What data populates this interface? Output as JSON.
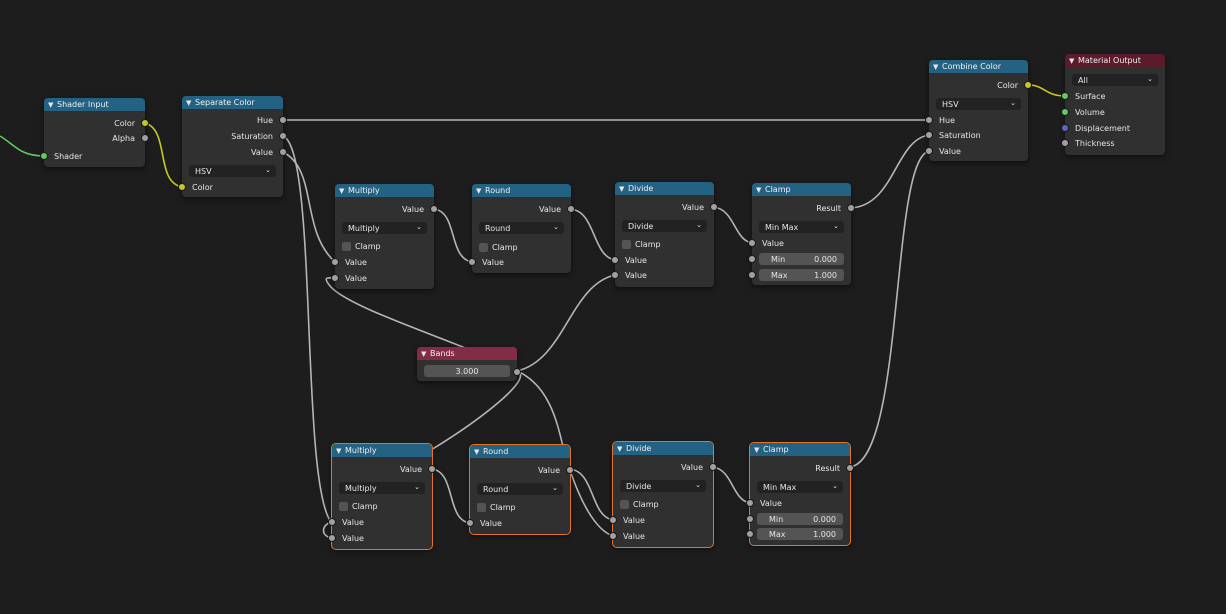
{
  "colors": {
    "background": "#1d1d1d",
    "node_body": "#303030",
    "header_blue": "#246283",
    "header_red": "#822c45",
    "header_output": "#5b1b2b",
    "selected_outline": "#e3752b",
    "link_grey": "#b5b5b5",
    "link_yellow": "#c7c729",
    "link_green": "#63c763"
  },
  "nodes": {
    "shader_input": {
      "title": "Shader Input",
      "out_color": "Color",
      "out_alpha": "Alpha",
      "in_shader": "Shader"
    },
    "separate_color": {
      "title": "Separate Color",
      "out_hue": "Hue",
      "out_saturation": "Saturation",
      "out_value": "Value",
      "mode": "HSV",
      "in_color": "Color"
    },
    "combine_color": {
      "title": "Combine Color",
      "out_color": "Color",
      "mode": "HSV",
      "in_hue": "Hue",
      "in_saturation": "Saturation",
      "in_value": "Value"
    },
    "material_output": {
      "title": "Material Output",
      "target": "All",
      "in_surface": "Surface",
      "in_volume": "Volume",
      "in_displacement": "Displacement",
      "in_thickness": "Thickness"
    },
    "multiply_top": {
      "title": "Multiply",
      "out_value": "Value",
      "operation": "Multiply",
      "clamp": "Clamp",
      "in_value_1": "Value",
      "in_value_2": "Value"
    },
    "round_top": {
      "title": "Round",
      "out_value": "Value",
      "operation": "Round",
      "clamp": "Clamp",
      "in_value": "Value"
    },
    "divide_top": {
      "title": "Divide",
      "out_value": "Value",
      "operation": "Divide",
      "clamp": "Clamp",
      "in_value_1": "Value",
      "in_value_2": "Value"
    },
    "clamp_top": {
      "title": "Clamp",
      "out_result": "Result",
      "type": "Min Max",
      "in_value": "Value",
      "min_label": "Min",
      "min_value": "0.000",
      "max_label": "Max",
      "max_value": "1.000"
    },
    "bands": {
      "title": "Bands",
      "value": "3.000"
    },
    "multiply_bottom": {
      "title": "Multiply",
      "out_value": "Value",
      "operation": "Multiply",
      "clamp": "Clamp",
      "in_value_1": "Value",
      "in_value_2": "Value"
    },
    "round_bottom": {
      "title": "Round",
      "out_value": "Value",
      "operation": "Round",
      "clamp": "Clamp",
      "in_value": "Value"
    },
    "divide_bottom": {
      "title": "Divide",
      "out_value": "Value",
      "operation": "Divide",
      "clamp": "Clamp",
      "in_value_1": "Value",
      "in_value_2": "Value"
    },
    "clamp_bottom": {
      "title": "Clamp",
      "out_result": "Result",
      "type": "Min Max",
      "in_value": "Value",
      "min_label": "Min",
      "min_value": "0.000",
      "max_label": "Max",
      "max_value": "1.000"
    }
  }
}
